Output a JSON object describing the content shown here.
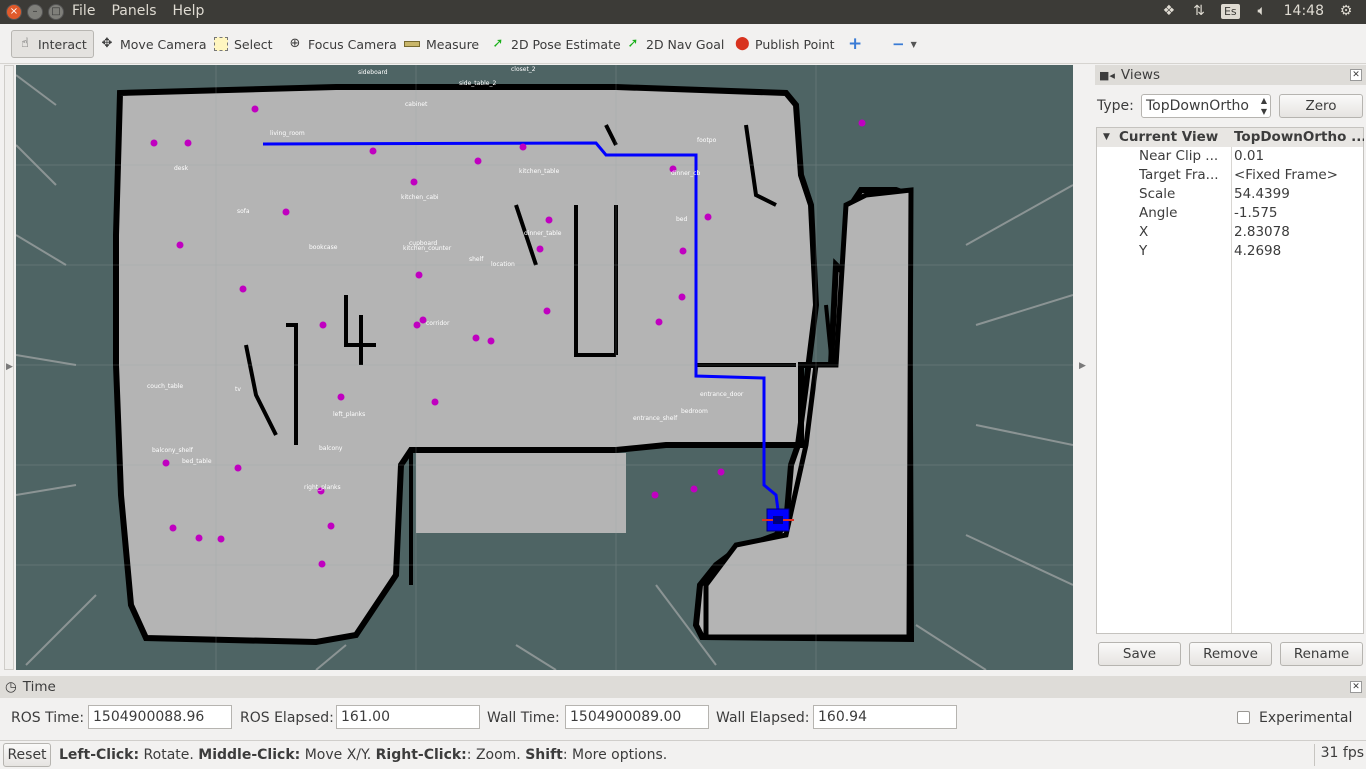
{
  "menubar": {
    "items": [
      "File",
      "Panels",
      "Help"
    ],
    "time": "14:48",
    "keyboard": "Es"
  },
  "toolbar": {
    "interact": "Interact",
    "move_camera": "Move Camera",
    "select": "Select",
    "focus_camera": "Focus Camera",
    "measure": "Measure",
    "pose_estimate": "2D Pose Estimate",
    "nav_goal": "2D Nav Goal",
    "publish_point": "Publish Point"
  },
  "map": {
    "labels": [
      "living_room",
      "sideboard",
      "kitchen_table",
      "kitchen_cabi",
      "desk",
      "sofa",
      "bookcase",
      "cupboard",
      "shelf",
      "dinner_table",
      "bed",
      "couch_table",
      "tv",
      "left_planks",
      "balcony",
      "balcony_shelf",
      "right_planks",
      "entrance_door",
      "entrance_shelf",
      "bedroom",
      "footpo",
      "dinner_cb",
      "kitchen_counter",
      "location",
      "corridor",
      "cabinet",
      "side_table_2",
      "closet_2",
      "bed_table"
    ],
    "colors": {
      "free": "#b4b4b4",
      "unknown": "#4e6464",
      "wall": "#000000",
      "path": "#0000ff",
      "marker": "#c000c0",
      "robot": "#0000ff"
    }
  },
  "views": {
    "title": "Views",
    "type_label": "Type:",
    "type_value": "TopDownOrtho",
    "zero": "Zero",
    "col_name": "Current View",
    "col_value": "TopDownOrtho ...",
    "props": [
      {
        "name": "Near Clip ...",
        "value": "0.01"
      },
      {
        "name": "Target Fra...",
        "value": "<Fixed Frame>"
      },
      {
        "name": "Scale",
        "value": "54.4399"
      },
      {
        "name": "Angle",
        "value": "-1.575"
      },
      {
        "name": "X",
        "value": "2.83078"
      },
      {
        "name": "Y",
        "value": "4.2698"
      }
    ],
    "save": "Save",
    "remove": "Remove",
    "rename": "Rename"
  },
  "time": {
    "title": "Time",
    "ros_time_label": "ROS Time:",
    "ros_time": "1504900088.96",
    "ros_elapsed_label": "ROS Elapsed:",
    "ros_elapsed": "161.00",
    "wall_time_label": "Wall Time:",
    "wall_time": "1504900089.00",
    "wall_elapsed_label": "Wall Elapsed:",
    "wall_elapsed": "160.94",
    "experimental": "Experimental"
  },
  "status": {
    "reset": "Reset",
    "hint_b1": "Left-Click:",
    "hint_t1": " Rotate. ",
    "hint_b2": "Middle-Click:",
    "hint_t2": " Move X/Y. ",
    "hint_b3": "Right-Click:",
    "hint_t3": ": Zoom. ",
    "hint_b4": "Shift",
    "hint_t4": ": More options.",
    "fps": "31 fps"
  }
}
